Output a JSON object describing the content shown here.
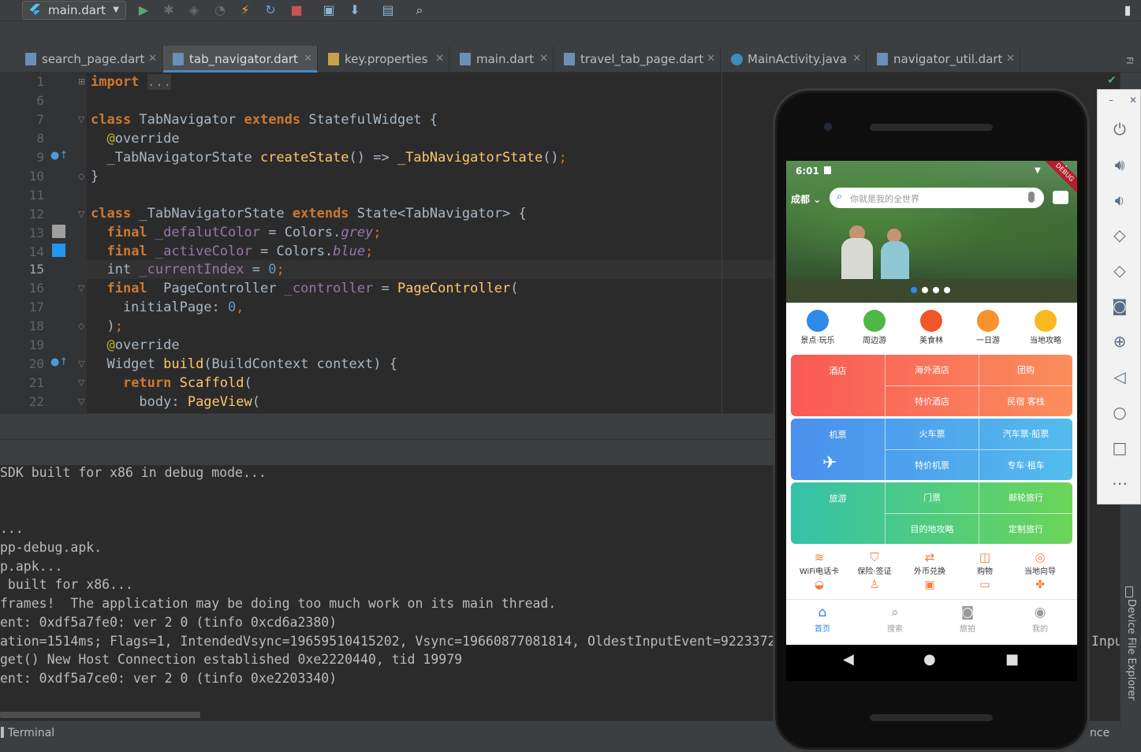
{
  "toolbar": {
    "run_config": "main.dart"
  },
  "tabs": [
    {
      "label": "search_page.dart"
    },
    {
      "label": "tab_navigator.dart"
    },
    {
      "label": "key.properties"
    },
    {
      "label": "main.dart"
    },
    {
      "label": "travel_tab_page.dart"
    },
    {
      "label": "MainActivity.java"
    },
    {
      "label": "navigator_util.dart"
    }
  ],
  "editor": {
    "line_numbers": [
      "1",
      "6",
      "7",
      "8",
      "9",
      "10",
      "11",
      "12",
      "13",
      "14",
      "15",
      "16",
      "17",
      "18",
      "19",
      "20",
      "21",
      "22"
    ],
    "current_line": "15"
  },
  "console": {
    "lines": [
      "SDK built for x86 in debug mode...",
      "",
      "...",
      "pp-debug.apk.",
      "p.apk...",
      " built for x86...",
      "frames!  The application may be doing too much work on its main thread.",
      "ent: 0xdf5a7fe0: ver 2 0 (tinfo 0xcd6a2380)",
      "ation=1514ms; Flags=1, IntendedVsync=19659510415202, Vsync=19660877081814, OldestInputEvent=9223372",
      "get() New Host Connection established 0xe2220440, tid 19979",
      "ent: 0xdf5a7ce0: ver 2 0 (tinfo 0xe2203340)"
    ],
    "right_fragment": "Inpu"
  },
  "status_bar": {
    "terminal": "Terminal",
    "right_fragment": "nce"
  },
  "side_panel": {
    "device_file_explorer": "Device File Explorer",
    "fl": "Fl"
  },
  "app": {
    "time": "6:01",
    "debug": "DEBUG",
    "city": "成都",
    "search_placeholder": "你就是我的全世界",
    "local_nav": [
      "景点·玩乐",
      "周边游",
      "美食林",
      "一日游",
      "当地攻略"
    ],
    "hotel_row": {
      "main": "酒店",
      "cells": [
        "海外酒店",
        "团购",
        "特价酒店",
        "民宿 客栈"
      ]
    },
    "flight_row": {
      "main": "机票",
      "cells": [
        "火车票",
        "汽车票·船票",
        "特价机票",
        "专车·租车"
      ]
    },
    "travel_row": {
      "main": "旅游",
      "cells": [
        "门票",
        "邮轮旅行",
        "目的地攻略",
        "定制旅行"
      ]
    },
    "sub_nav": [
      "WiFi电话卡",
      "保险·签证",
      "外币兑换",
      "购物",
      "当地向导"
    ],
    "bottom_nav": [
      "首页",
      "搜索",
      "旅拍",
      "我的"
    ],
    "accent": "#2f89e6"
  }
}
